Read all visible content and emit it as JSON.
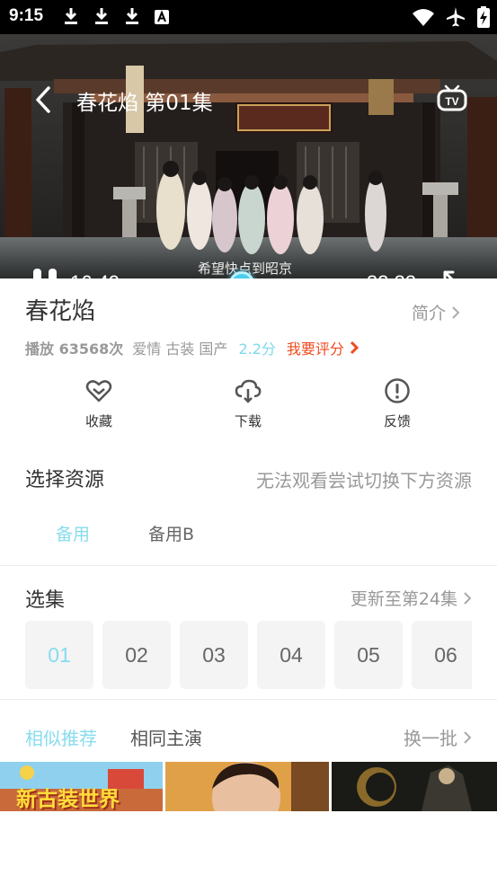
{
  "statusbar": {
    "time": "9:15"
  },
  "player": {
    "title": "春花焰 第01集",
    "current_time": "16:49",
    "total_time": "33:33",
    "subtitle": "希望快点到昭京",
    "sign_text": "馆驿北荆",
    "progress": 0.5
  },
  "show": {
    "title": "春花焰",
    "intro_label": "简介",
    "plays": "播放 63568次",
    "genres": "爱情 古装 国产",
    "score": "2.2分",
    "rate_label": "我要评分"
  },
  "actions": [
    {
      "label": "收藏",
      "icon": "heart-icon"
    },
    {
      "label": "下载",
      "icon": "cloud-download-icon"
    },
    {
      "label": "反馈",
      "icon": "exclamation-icon"
    }
  ],
  "sources": {
    "title": "选择资源",
    "hint": "无法观看尝试切换下方资源",
    "tabs": [
      "备用",
      "备用B"
    ],
    "active_tab": 0
  },
  "episodes": {
    "title": "选集",
    "update_label": "更新至第24集",
    "items": [
      "01",
      "02",
      "03",
      "04",
      "05",
      "06"
    ],
    "active": 0
  },
  "recommend": {
    "tabs": [
      "相似推荐",
      "相同主演"
    ],
    "active_tab": 0,
    "refresh_label": "换一批",
    "tile1_text": "新古装世界"
  },
  "colors": {
    "accent": "#87dcef",
    "rate": "#f04a1e",
    "text_secondary": "#999999"
  }
}
